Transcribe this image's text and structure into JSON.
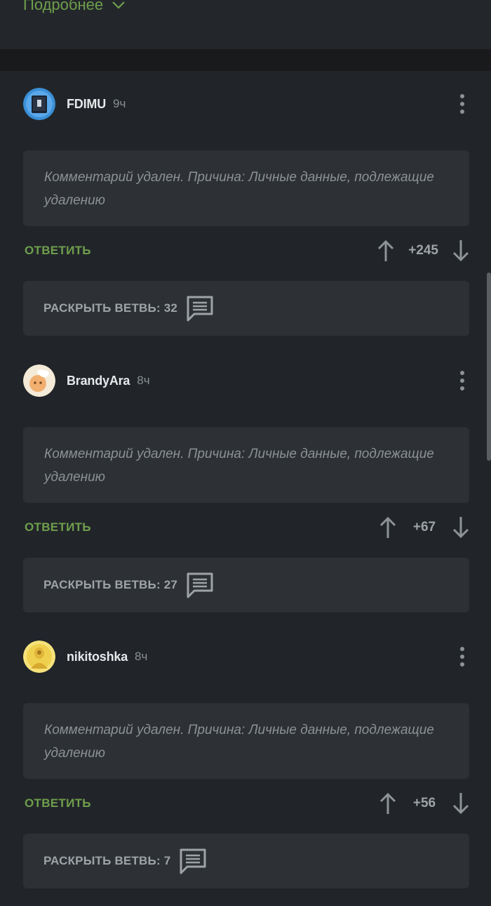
{
  "more_link": {
    "label": "Подробнее",
    "icon": "chevron-down-icon"
  },
  "comments": [
    {
      "username": "FDIMU",
      "time": "9ч",
      "text": "Комментарий удален. Причина: Личные данные, подлежащие удалению",
      "reply_label": "ОТВЕТИТЬ",
      "score": "+245",
      "expand_label": "РАСКРЫТЬ ВЕТВЬ: 32"
    },
    {
      "username": "BrandyAra",
      "time": "8ч",
      "text": "Комментарий удален. Причина: Личные данные, подлежащие удалению",
      "reply_label": "ОТВЕТИТЬ",
      "score": "+67",
      "expand_label": "РАСКРЫТЬ ВЕТВЬ: 27"
    },
    {
      "username": "nikitoshka",
      "time": "8ч",
      "text": "Комментарий удален. Причина: Личные данные, подлежащие удалению",
      "reply_label": "ОТВЕТИТЬ",
      "score": "+56",
      "expand_label": "РАСКРЫТЬ ВЕТВЬ: 7"
    }
  ],
  "colors": {
    "background": "#212529",
    "card": "#2d3135",
    "accent_green": "#6f9e4c",
    "muted_text": "#8c9196"
  }
}
